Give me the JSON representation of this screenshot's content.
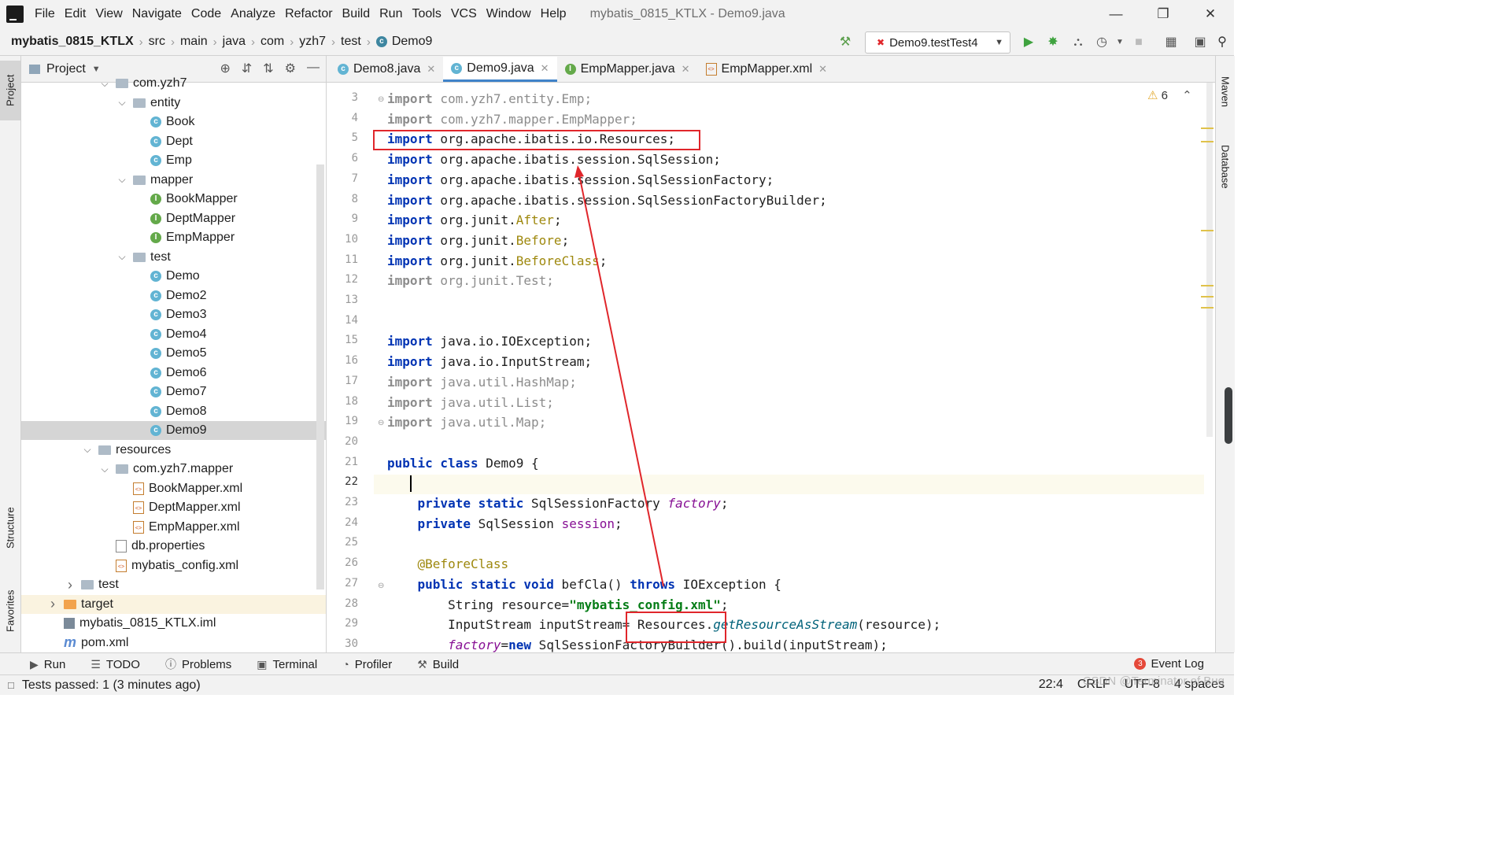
{
  "menu": [
    "File",
    "Edit",
    "View",
    "Navigate",
    "Code",
    "Analyze",
    "Refactor",
    "Build",
    "Run",
    "Tools",
    "VCS",
    "Window",
    "Help"
  ],
  "window_title": "mybatis_0815_KTLX - Demo9.java",
  "breadcrumb": {
    "project": "mybatis_0815_KTLX",
    "parts": [
      "src",
      "main",
      "java",
      "com",
      "yzh7",
      "test"
    ],
    "file": "Demo9"
  },
  "run_config": "Demo9.testTest4",
  "left_tabs": {
    "project": "Project",
    "structure": "Structure",
    "favorites": "Favorites"
  },
  "right_tabs": {
    "maven": "Maven",
    "database": "Database"
  },
  "project_panel": {
    "title": "Project"
  },
  "tree": [
    {
      "label": "com.yzh7",
      "type": "folder",
      "depth": 5,
      "arrow": "down"
    },
    {
      "label": "entity",
      "type": "folder",
      "depth": 6,
      "arrow": "down"
    },
    {
      "label": "Book",
      "type": "class",
      "depth": 7
    },
    {
      "label": "Dept",
      "type": "class",
      "depth": 7
    },
    {
      "label": "Emp",
      "type": "class",
      "depth": 7
    },
    {
      "label": "mapper",
      "type": "folder",
      "depth": 6,
      "arrow": "down"
    },
    {
      "label": "BookMapper",
      "type": "interface",
      "depth": 7
    },
    {
      "label": "DeptMapper",
      "type": "interface",
      "depth": 7
    },
    {
      "label": "EmpMapper",
      "type": "interface",
      "depth": 7
    },
    {
      "label": "test",
      "type": "folder",
      "depth": 6,
      "arrow": "down"
    },
    {
      "label": "Demo",
      "type": "testclass",
      "depth": 7
    },
    {
      "label": "Demo2",
      "type": "testclass",
      "depth": 7
    },
    {
      "label": "Demo3",
      "type": "testclass",
      "depth": 7
    },
    {
      "label": "Demo4",
      "type": "testclass",
      "depth": 7
    },
    {
      "label": "Demo5",
      "type": "testclass",
      "depth": 7
    },
    {
      "label": "Demo6",
      "type": "testclass",
      "depth": 7
    },
    {
      "label": "Demo7",
      "type": "testclass",
      "depth": 7
    },
    {
      "label": "Demo8",
      "type": "testclass",
      "depth": 7
    },
    {
      "label": "Demo9",
      "type": "testclass",
      "depth": 7,
      "selected": true
    },
    {
      "label": "resources",
      "type": "resfolder",
      "depth": 4,
      "arrow": "down"
    },
    {
      "label": "com.yzh7.mapper",
      "type": "folder",
      "depth": 5,
      "arrow": "down"
    },
    {
      "label": "BookMapper.xml",
      "type": "xml",
      "depth": 6
    },
    {
      "label": "DeptMapper.xml",
      "type": "xml",
      "depth": 6
    },
    {
      "label": "EmpMapper.xml",
      "type": "xml",
      "depth": 6
    },
    {
      "label": "db.properties",
      "type": "props",
      "depth": 5
    },
    {
      "label": "mybatis_config.xml",
      "type": "xml",
      "depth": 5
    },
    {
      "label": "test",
      "type": "folder",
      "depth": 3,
      "arrow": "right"
    },
    {
      "label": "target",
      "type": "orangefolder",
      "depth": 2,
      "arrow": "right",
      "highlight": true
    },
    {
      "label": "mybatis_0815_KTLX.iml",
      "type": "iml",
      "depth": 2
    },
    {
      "label": "pom.xml",
      "type": "maven",
      "depth": 2
    }
  ],
  "tabs": [
    {
      "label": "Demo8.java",
      "icon": "testclass"
    },
    {
      "label": "Demo9.java",
      "icon": "class",
      "active": true
    },
    {
      "label": "EmpMapper.java",
      "icon": "interface"
    },
    {
      "label": "EmpMapper.xml",
      "icon": "xml"
    }
  ],
  "warnings_count": "6",
  "code": [
    {
      "n": "3",
      "segs": [
        [
          "kw-gray",
          "import"
        ],
        [
          "gray",
          " com.yzh7.entity.Emp;"
        ]
      ]
    },
    {
      "n": "4",
      "segs": [
        [
          "kw-gray",
          "import"
        ],
        [
          "gray",
          " com.yzh7.mapper.EmpMapper;"
        ]
      ]
    },
    {
      "n": "5",
      "segs": [
        [
          "kw",
          "import"
        ],
        [
          "pkg",
          " org.apache.ibatis.io.Resources;"
        ]
      ]
    },
    {
      "n": "6",
      "segs": [
        [
          "kw",
          "import"
        ],
        [
          "pkg",
          " org.apache.ibatis.session.SqlSession;"
        ]
      ]
    },
    {
      "n": "7",
      "segs": [
        [
          "kw",
          "import"
        ],
        [
          "pkg",
          " org.apache.ibatis.session.SqlSessionFactory;"
        ]
      ]
    },
    {
      "n": "8",
      "segs": [
        [
          "kw",
          "import"
        ],
        [
          "pkg",
          " org.apache.ibatis.session.SqlSessionFactoryBuilder;"
        ]
      ]
    },
    {
      "n": "9",
      "segs": [
        [
          "kw",
          "import"
        ],
        [
          "pkg",
          " org.junit."
        ],
        [
          "olive",
          "After"
        ],
        [
          "pkg",
          ";"
        ]
      ]
    },
    {
      "n": "10",
      "segs": [
        [
          "kw",
          "import"
        ],
        [
          "pkg",
          " org.junit."
        ],
        [
          "olive",
          "Before"
        ],
        [
          "pkg",
          ";"
        ]
      ]
    },
    {
      "n": "11",
      "segs": [
        [
          "kw",
          "import"
        ],
        [
          "pkg",
          " org.junit."
        ],
        [
          "olive",
          "BeforeClass"
        ],
        [
          "pkg",
          ";"
        ]
      ]
    },
    {
      "n": "12",
      "segs": [
        [
          "kw-gray",
          "import"
        ],
        [
          "gray",
          " org.junit.Test;"
        ]
      ]
    },
    {
      "n": "13",
      "segs": []
    },
    {
      "n": "14",
      "segs": []
    },
    {
      "n": "15",
      "segs": [
        [
          "kw",
          "import"
        ],
        [
          "pkg",
          " java.io.IOException;"
        ]
      ]
    },
    {
      "n": "16",
      "segs": [
        [
          "kw",
          "import"
        ],
        [
          "pkg",
          " java.io.InputStream;"
        ]
      ]
    },
    {
      "n": "17",
      "segs": [
        [
          "kw-gray",
          "import"
        ],
        [
          "gray",
          " java.util.HashMap;"
        ]
      ]
    },
    {
      "n": "18",
      "segs": [
        [
          "kw-gray",
          "import"
        ],
        [
          "gray",
          " java.util.List;"
        ]
      ]
    },
    {
      "n": "19",
      "segs": [
        [
          "kw-gray",
          "import"
        ],
        [
          "gray",
          " java.util.Map;"
        ]
      ]
    },
    {
      "n": "20",
      "segs": []
    },
    {
      "n": "21",
      "segs": [
        [
          "kw",
          "public class"
        ],
        [
          "pkg",
          " Demo9 {"
        ]
      ]
    },
    {
      "n": "22",
      "segs": []
    },
    {
      "n": "23",
      "segs": [
        [
          "pkg",
          "    "
        ],
        [
          "kw",
          "private static"
        ],
        [
          "pkg",
          " SqlSessionFactory "
        ],
        [
          "fld",
          "factory"
        ],
        [
          "pkg",
          ";"
        ]
      ]
    },
    {
      "n": "24",
      "segs": [
        [
          "pkg",
          "    "
        ],
        [
          "kw",
          "private"
        ],
        [
          "pkg",
          " SqlSession "
        ],
        [
          "fld2",
          "session"
        ],
        [
          "pkg",
          ";"
        ]
      ]
    },
    {
      "n": "25",
      "segs": []
    },
    {
      "n": "26",
      "segs": [
        [
          "pkg",
          "    "
        ],
        [
          "ann",
          "@BeforeClass"
        ]
      ]
    },
    {
      "n": "27",
      "segs": [
        [
          "pkg",
          "    "
        ],
        [
          "kw",
          "public static void"
        ],
        [
          "pkg",
          " befCla() "
        ],
        [
          "kw",
          "throws"
        ],
        [
          "pkg",
          " IOException {"
        ]
      ]
    },
    {
      "n": "28",
      "segs": [
        [
          "pkg",
          "        String resource="
        ],
        [
          "str",
          "\"mybatis_config.xml\""
        ],
        [
          "pkg",
          ";"
        ]
      ]
    },
    {
      "n": "29",
      "segs": [
        [
          "pkg",
          "        InputStream inputStream= Resources."
        ],
        [
          "meth",
          "getResourceAsStream"
        ],
        [
          "pkg",
          "(resource);"
        ]
      ]
    },
    {
      "n": "30",
      "segs": [
        [
          "pkg",
          "        "
        ],
        [
          "fld",
          "factory"
        ],
        [
          "pkg",
          "="
        ],
        [
          "kw",
          "new"
        ],
        [
          "pkg",
          " SqlSessionFactoryBuilder().build(inputStream);"
        ]
      ]
    }
  ],
  "bottom_tools": [
    "Run",
    "TODO",
    "Problems",
    "Terminal",
    "Profiler",
    "Build"
  ],
  "event_log": {
    "count": "3",
    "label": "Event Log"
  },
  "status": {
    "message": "Tests passed: 1 (3 minutes ago)",
    "position": "22:4",
    "line_sep": "CRLF",
    "encoding": "UTF-8",
    "indent": "4 spaces"
  },
  "watermark": "CSDN @Terminator of Bug",
  "colors": {
    "accent": "#4083c9",
    "annotation_red": "#e0262b",
    "keyword": "#0033b3",
    "string": "#067d17"
  }
}
